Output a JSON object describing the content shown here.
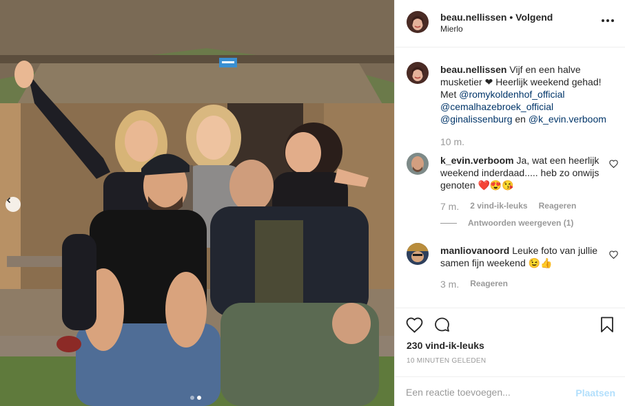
{
  "post": {
    "photo_alt": "",
    "carousel": {
      "slide_count": 2,
      "active_index": 1
    }
  },
  "header": {
    "username": "beau.nellissen",
    "separator": " • ",
    "follow_status": "Volgend",
    "location": "Mierlo",
    "more_icon": "more-horizontal-icon"
  },
  "caption": {
    "username": "beau.nellissen",
    "text_parts": [
      {
        "type": "text",
        "value": " Vijf en een halve musketier ❤ Heerlijk weekend gehad! Met "
      },
      {
        "type": "mention",
        "value": "@romykoldenhof_official"
      },
      {
        "type": "text",
        "value": " "
      },
      {
        "type": "mention",
        "value": "@cemalhazebroek_official"
      },
      {
        "type": "text",
        "value": " "
      },
      {
        "type": "mention",
        "value": "@ginalissenburg"
      },
      {
        "type": "text",
        "value": " en "
      },
      {
        "type": "mention",
        "value": "@k_evin.verboom"
      }
    ],
    "time": "10 m."
  },
  "comments": [
    {
      "username": "k_evin.verboom",
      "text": " Ja, wat een heerlijk weekend inderdaad..... heb zo onwijs genoten ❤️😍😘",
      "time": "7 m.",
      "likes": "2 vind-ik-leuks",
      "reply": "Reageren",
      "view_replies": "Antwoorden weergeven (1)"
    },
    {
      "username": "manliovanoord",
      "text": " Leuke foto van jullie samen fijn weekend 😉👍",
      "time": "3 m.",
      "reply": "Reageren"
    }
  ],
  "actions": {
    "like_icon": "heart-icon",
    "comment_icon": "comment-icon",
    "save_icon": "bookmark-icon",
    "likes_count": "230 vind-ik-leuks",
    "posted_ago": "10 MINUTEN GELEDEN"
  },
  "add_comment": {
    "placeholder": "Een reactie toevoegen...",
    "value": "",
    "submit_label": "Plaatsen"
  },
  "colors": {
    "text": "#262626",
    "secondary": "#999999",
    "mention": "#003569",
    "submit_disabled": "#b2dffc",
    "border": "#efefef",
    "heart_emoji": "#ed4956"
  }
}
